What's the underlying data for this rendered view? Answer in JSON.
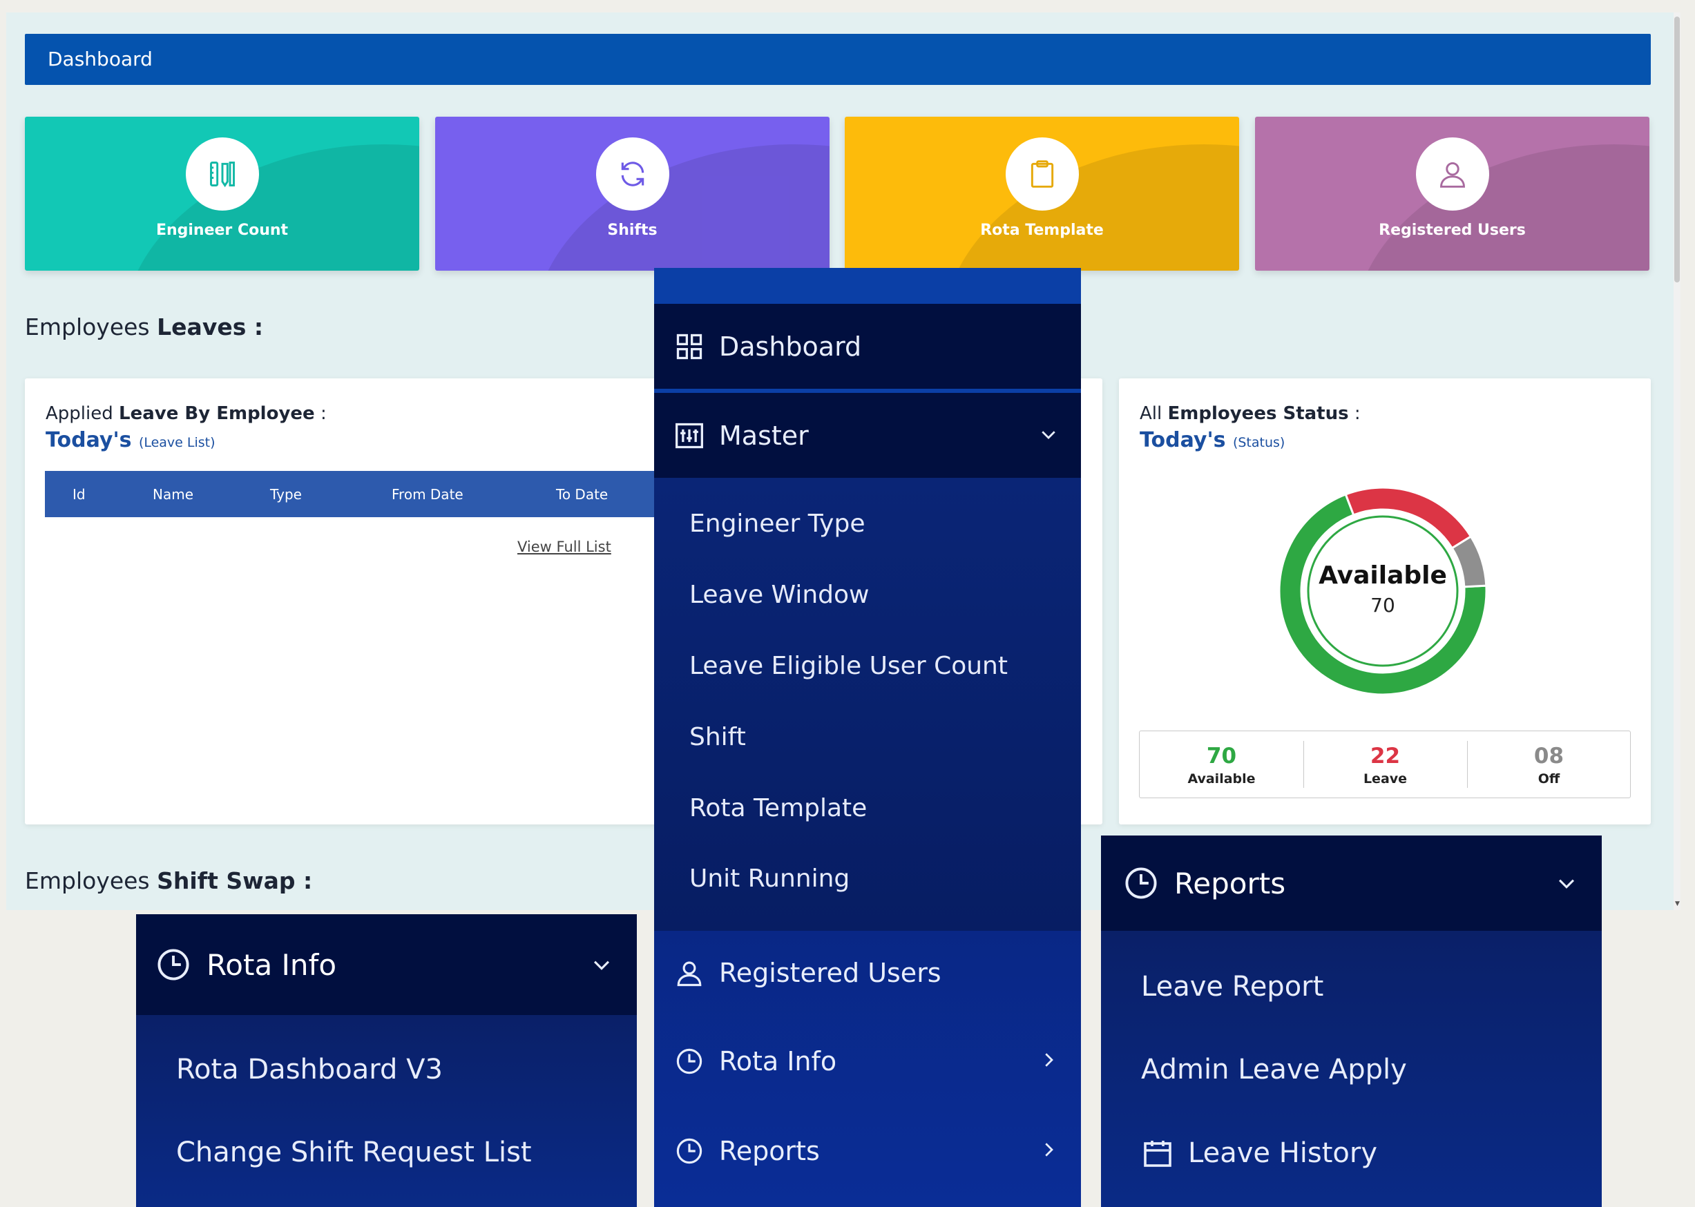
{
  "header": {
    "title": "Dashboard"
  },
  "cards": [
    {
      "label": "Engineer Count",
      "icon": "ruler-pencil-icon",
      "color": "#12c8b5"
    },
    {
      "label": "Shifts",
      "icon": "refresh-icon",
      "color": "#7760ee"
    },
    {
      "label": "Rota Template",
      "icon": "clipboard-icon",
      "color": "#fdbb0b"
    },
    {
      "label": "Registered Users",
      "icon": "user-icon",
      "color": "#b572aa"
    }
  ],
  "leaves_section": {
    "prefix": "Employees",
    "strong": "Leaves :"
  },
  "shift_swap_section": {
    "prefix": "Employees",
    "strong": "Shift Swap :"
  },
  "leave_panel": {
    "title_prefix": "Applied",
    "title_strong": "Leave By Employee",
    "title_suffix": ":",
    "sub_strong": "Today's",
    "sub_small": "(Leave List)",
    "columns": [
      "Id",
      "Name",
      "Type",
      "From Date",
      "To Date"
    ],
    "view_full": "View Full List"
  },
  "status_panel": {
    "title_prefix": "All",
    "title_strong": "Employees Status",
    "title_suffix": ":",
    "sub_strong": "Today's",
    "sub_small": "(Status)",
    "center_label": "Available",
    "center_value": "70",
    "stats": [
      {
        "value": "70",
        "label": "Available",
        "color": "#2ea843"
      },
      {
        "value": "22",
        "label": "Leave",
        "color": "#dc3545"
      },
      {
        "value": "08",
        "label": "Off",
        "color": "#8a8a8a"
      }
    ]
  },
  "chart_data": {
    "type": "pie",
    "categories": [
      "Available",
      "Leave",
      "Off"
    ],
    "values": [
      70,
      22,
      8
    ],
    "colors": [
      "#2ea843",
      "#dc3545",
      "#8f8f8f"
    ]
  },
  "sidebar": {
    "dashboard": "Dashboard",
    "master": "Master",
    "master_items": [
      "Engineer Type",
      "Leave Window",
      "Leave Eligible User Count",
      "Shift",
      "Rota Template",
      "Unit Running"
    ],
    "registered_users": "Registered Users",
    "rota_info": "Rota Info",
    "reports": "Reports"
  },
  "rota_popup": {
    "title": "Rota Info",
    "items": [
      "Rota Dashboard V3",
      "Change Shift Request List"
    ]
  },
  "reports_popup": {
    "title": "Reports",
    "items": [
      "Leave Report",
      "Admin Leave Apply",
      "Leave History"
    ]
  }
}
